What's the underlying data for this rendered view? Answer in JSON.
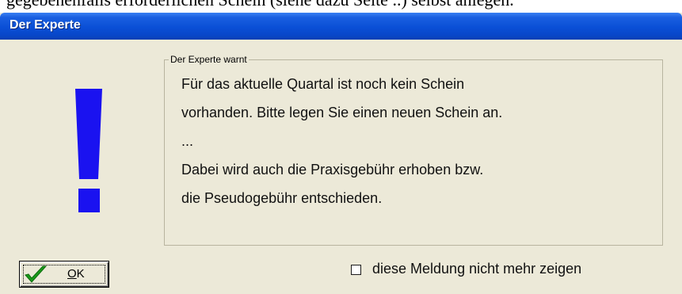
{
  "top_strip_text": "gegebenenfalls erforderlichen Schein (siehe dazu Seite ..) selbst anlegen.",
  "window": {
    "title": "Der Experte"
  },
  "group": {
    "legend": "Der Experte warnt",
    "lines": [
      "Für das aktuelle Quartal ist noch kein Schein",
      "vorhanden. Bitte legen Sie einen neuen Schein an.",
      "...",
      "Dabei wird auch die Praxisgebühr erhoben bzw.",
      "die Pseudogebühr entschieden."
    ]
  },
  "icon": {
    "name": "exclamation-icon",
    "color": "#1a12f0"
  },
  "ok_button": {
    "label_mnemonic": "O",
    "label_rest": "K",
    "icon": "checkmark-icon",
    "icon_color": "#1a9a1a"
  },
  "checkbox": {
    "label": "diese Meldung nicht mehr zeigen",
    "checked": false
  },
  "colors": {
    "titlebar": "#0a4fd6",
    "dialog_bg": "#ece9d8"
  }
}
